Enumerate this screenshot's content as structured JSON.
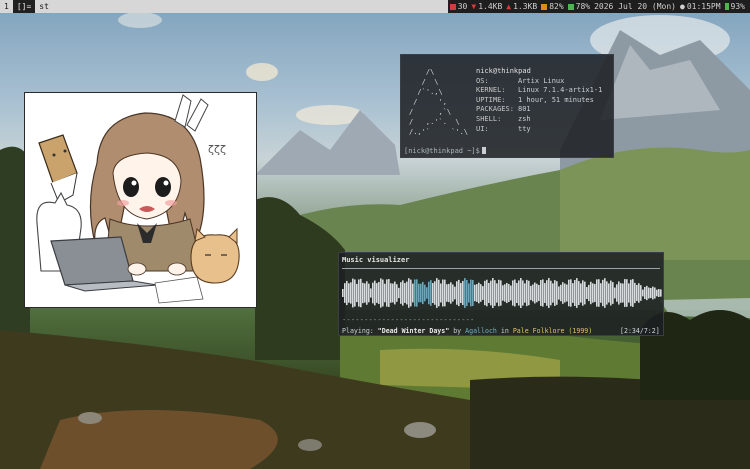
{
  "bar": {
    "workspace": "1",
    "layout": "[]=",
    "window_title": "st",
    "status": {
      "cpu": "30",
      "net_down": "1.4KB",
      "net_up": "1.3KB",
      "mem": "82%",
      "volume": "78%",
      "date": "2026 Jul 20 (Mon)",
      "time": "01:15PM",
      "battery": "93%"
    },
    "colors": {
      "accent_red": "#d23c3c",
      "accent_orange": "#e08a1e",
      "accent_green": "#4fb34f",
      "bar_bg": "#d7d7d7",
      "status_bg": "#1e1e1e"
    }
  },
  "neofetch": {
    "userhost": "nick@thinkpad",
    "fields": [
      {
        "key": "OS:",
        "value": "Artix Linux"
      },
      {
        "key": "KERNEL:",
        "value": "Linux 7.1.4-artix1-1"
      },
      {
        "key": "UPTIME:",
        "value": "1 hour, 51 minutes"
      },
      {
        "key": "PACKAGES:",
        "value": "801"
      },
      {
        "key": "SHELL:",
        "value": "zsh"
      },
      {
        "key": "UI:",
        "value": "tty"
      }
    ],
    "logo_lines": [
      "    /\\",
      "   /  \\",
      "  /`'.,\\",
      " /     ',",
      "/      ,`\\",
      "/   ,.'`.  \\",
      "/.,'`     `'.\\"
    ],
    "prompt": "[nick@thinkpad ~]$"
  },
  "visualizer": {
    "title": "Music visualizer",
    "dashes": "------------------------------",
    "playing_label": "Playing:",
    "song": "\"Dead Winter Days\"",
    "by": "by",
    "artist": "Agalloch",
    "in": "in",
    "album": "Pale Folklore (1999)",
    "time": "[2:34/7:2]"
  }
}
